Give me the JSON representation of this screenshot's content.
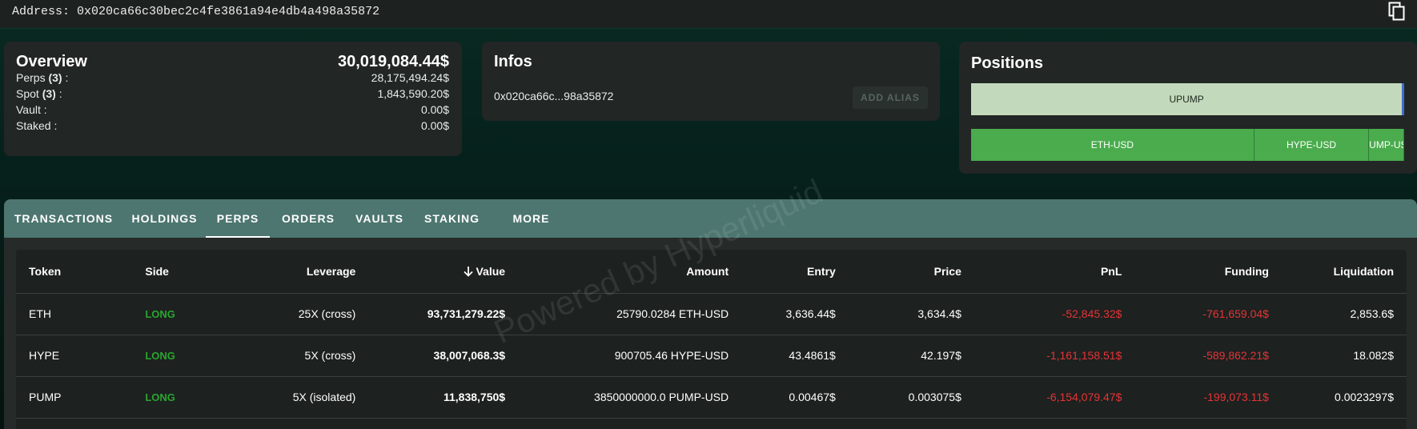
{
  "address_bar": {
    "label": "Address: 0x020ca66c30bec2c4fe3861a94e4db4a498a35872"
  },
  "overview": {
    "title": "Overview",
    "total": "30,019,084.44$",
    "rows": [
      {
        "label": "Perps",
        "count": "(3)",
        "suffix": " :",
        "value": "28,175,494.24$"
      },
      {
        "label": "Spot",
        "count": "(3)",
        "suffix": " :",
        "value": "1,843,590.20$"
      },
      {
        "label": "Vault :",
        "count": "",
        "suffix": "",
        "value": "0.00$"
      },
      {
        "label": "Staked :",
        "count": "",
        "suffix": "",
        "value": "0.00$"
      }
    ]
  },
  "infos": {
    "title": "Infos",
    "short_address": "0x020ca66c...98a35872",
    "add_alias_label": "ADD ALIAS"
  },
  "positions": {
    "title": "Positions",
    "spot": [
      {
        "label": "UPUMP",
        "share": 0.995
      }
    ],
    "perps": [
      {
        "label": "ETH-USD",
        "share": 0.654
      },
      {
        "label": "HYPE-USD",
        "share": 0.265
      },
      {
        "label": "UMP-US",
        "share": 0.081
      }
    ]
  },
  "tabs": [
    "TRANSACTIONS",
    "HOLDINGS",
    "PERPS",
    "ORDERS",
    "VAULTS",
    "STAKING",
    "MORE"
  ],
  "active_tab": "PERPS",
  "table": {
    "headers": [
      "Token",
      "Side",
      "Leverage",
      "Value",
      "Amount",
      "Entry",
      "Price",
      "PnL",
      "Funding",
      "Liquidation"
    ],
    "sorted_column": "Value",
    "rows": [
      {
        "token": "ETH",
        "side": "LONG",
        "leverage": "25X (cross)",
        "value": "93,731,279.22$",
        "amount": "25790.0284 ETH-USD",
        "entry": "3,636.44$",
        "price": "3,634.4$",
        "pnl": "-52,845.32$",
        "funding": "-761,659.04$",
        "liquidation": "2,853.6$"
      },
      {
        "token": "HYPE",
        "side": "LONG",
        "leverage": "5X (cross)",
        "value": "38,007,068.3$",
        "amount": "900705.46 HYPE-USD",
        "entry": "43.4861$",
        "price": "42.197$",
        "pnl": "-1,161,158.51$",
        "funding": "-589,862.21$",
        "liquidation": "18.082$"
      },
      {
        "token": "PUMP",
        "side": "LONG",
        "leverage": "5X (isolated)",
        "value": "11,838,750$",
        "amount": "3850000000.0 PUMP-USD",
        "entry": "0.00467$",
        "price": "0.003075$",
        "pnl": "-6,154,079.47$",
        "funding": "-199,073.11$",
        "liquidation": "0.0023297$"
      }
    ]
  },
  "watermark": "Powered by Hyperliquid",
  "colors": {
    "long": "#2aa52f",
    "negative": "#e53434",
    "tab_bar": "#4d7670",
    "spot_bar": "#c3d9bb",
    "perp_bar": "#4aac4d"
  }
}
